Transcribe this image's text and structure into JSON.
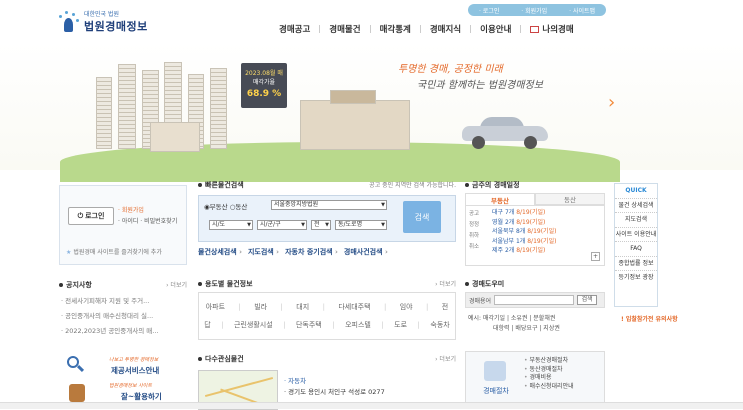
{
  "header": {
    "logo_small": "대한민국 법원",
    "logo_big": "법원경매정보",
    "util": [
      "· 로그인",
      "· 회원가입",
      "· 사이트맵"
    ],
    "nav": [
      "경매공고",
      "경매물건",
      "매각통계",
      "경매지식",
      "이용안내",
      "나의경매"
    ]
  },
  "hero": {
    "slogan1": "투명한 경매, 공정한 미래",
    "slogan2": "국민과 함께하는 법원경매정보",
    "sign_line1": "2023.08월 매",
    "sign_line2": "매각가율",
    "sign_value": "68.9 %"
  },
  "login": {
    "button": "로그인",
    "join": "· 회원가입",
    "find": "· 아이디 · 비밀번호찾기",
    "favorite": "법원경매 사이트를 즐겨찾기에 추가"
  },
  "quick_search": {
    "title": "빠른물건검색",
    "note": "공고 중인 지역만 검색 가능합니다.",
    "radio1": "부동산",
    "radio2": "동산",
    "court": "서울중앙지방법원",
    "sido": "시/도",
    "sigungu": "시/군/구",
    "all": "전",
    "dong": "동/도로명",
    "search": "검색",
    "tabs": [
      "물건상세검색",
      "지도검색",
      "자동차 중기검색",
      "경매사건검색"
    ]
  },
  "schedule": {
    "title": "금주의 경매일정",
    "tabs": [
      "부동산",
      "동산"
    ],
    "types": [
      "공고",
      "정정",
      "취하",
      "취소"
    ],
    "rows": [
      {
        "t": "대구 7개 ",
        "d": "8/19(기일)"
      },
      {
        "t": "영월 2개 ",
        "d": "8/19(기일)"
      },
      {
        "t": "서울북부 8개 ",
        "d": "8/19(기일)"
      },
      {
        "t": "서울남부 1개 ",
        "d": "8/19(기일)"
      },
      {
        "t": "제주 2개 ",
        "d": "8/19(기일)"
      }
    ]
  },
  "quick": {
    "title": "QUICK",
    "items": [
      "물건 상세검색",
      "지도검색",
      "사이트 이용안내",
      "FAQ",
      "종합법률 정보",
      "등기정보 광장"
    ],
    "caution": "입찰참가전 유의사항"
  },
  "notice": {
    "title": "공지사항",
    "more": "› 더보기",
    "items": [
      "· 전세사기피해자 지원 및 주거...",
      "· 공인중개사의 매수신청대리 실...",
      "· 2022,2023년 공인중개사의 매..."
    ]
  },
  "banners": {
    "b1_small": "나보고 투명한 경매정보",
    "b1": "제공서비스안내",
    "b2_small": "법원경매정보 사이트",
    "b2": "잘~활용하기"
  },
  "use": {
    "title": "용도별 물건정보",
    "more": "› 더보기",
    "row1": [
      "아파트",
      "빌라",
      "대지",
      "다세대주택",
      "임야",
      "전"
    ],
    "row2": [
      "답",
      "근린생활시설",
      "단독주택",
      "오피스텔",
      "도로",
      "숙동차"
    ]
  },
  "dict": {
    "title": "경매도우미",
    "label": "경매용어",
    "button": "검색",
    "line1": "예시: 매각기일 | 소유권 | 분할채권",
    "line2": "대항력 | 배당요구 | 지상권"
  },
  "interest": {
    "title": "다수관심물건",
    "more": "› 더보기",
    "items": [
      "· 자동차",
      "· 경기도 용인시 처인구 석성로 0277"
    ]
  },
  "service": {
    "label": "경매절차",
    "items": [
      "부동산경매절차",
      "동산경매절차",
      "경매비용",
      "매수신청대리안내"
    ]
  }
}
